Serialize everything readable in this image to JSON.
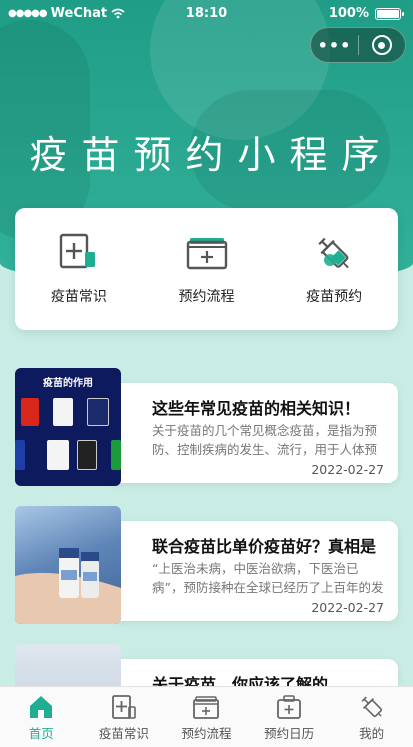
{
  "status_bar": {
    "carrier": "WeChat",
    "signal_dots": "●●●●●",
    "time": "18:10",
    "battery": "100%"
  },
  "capsule": {
    "more": "•••"
  },
  "hero": {
    "title": "疫苗预约小程序"
  },
  "categories": [
    {
      "label": "疫苗常识",
      "icon": "plus-card-icon"
    },
    {
      "label": "预约流程",
      "icon": "folder-plus-icon"
    },
    {
      "label": "疫苗预约",
      "icon": "syringe-icon"
    }
  ],
  "articles": [
    {
      "title": "这些年常见疫苗的相关知识！",
      "desc": "关于疫苗的几个常见概念疫苗，是指为预防、控制疾病的发生、流行，用于人体预防接种的预防性生物制品。",
      "date": "2022-02-27",
      "thumb_title": "疫苗的作用"
    },
    {
      "title": "联合疫苗比单价疫苗好？真相是",
      "desc": "“上医治未病，中医治欲病，下医治已病”，预防接种在全球已经历了上百年的发展历程",
      "date": "2022-02-27"
    },
    {
      "title": "关于疫苗，你应该了解的"
    }
  ],
  "tabs": [
    {
      "label": "首页",
      "icon": "home-icon",
      "active": true
    },
    {
      "label": "疫苗常识",
      "icon": "plus-card-icon"
    },
    {
      "label": "预约流程",
      "icon": "folder-plus-icon"
    },
    {
      "label": "预约日历",
      "icon": "briefcase-plus-icon"
    },
    {
      "label": "我的",
      "icon": "syringe-icon"
    }
  ],
  "colors": {
    "accent": "#1fae92",
    "hero": "#2aa891",
    "background": "#c9ede4"
  }
}
